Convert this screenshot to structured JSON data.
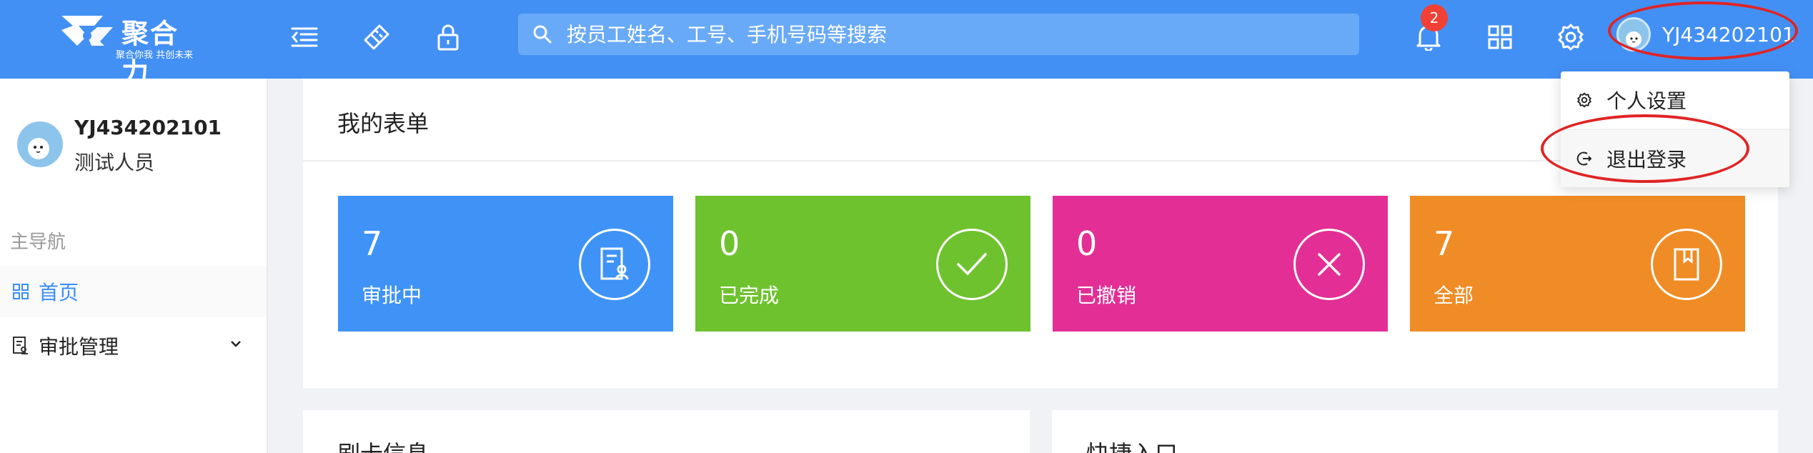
{
  "header": {
    "logo_name": "聚合力",
    "logo_slogan": "聚合你我 共创未来",
    "search_placeholder": "按员工姓名、工号、手机号码等搜索",
    "notification_count": "2",
    "user_name": "YJ434202101",
    "bg_color": "#4390f5"
  },
  "sidebar": {
    "user_name": "YJ434202101",
    "user_role": "测试人员",
    "section_title": "主导航",
    "items": [
      {
        "label": "首页",
        "icon": "grid-icon",
        "active": true
      },
      {
        "label": "审批管理",
        "icon": "approval-doc-icon",
        "expand_icon": "chevron-down-icon"
      }
    ]
  },
  "main": {
    "forms_card": {
      "title": "我的表单",
      "stats": [
        {
          "value": "7",
          "label": "审批中",
          "color": "#3f93f7",
          "icon": "form-doc-icon"
        },
        {
          "value": "0",
          "label": "已完成",
          "color": "#6ec22e",
          "icon": "check-icon"
        },
        {
          "value": "0",
          "label": "已撤销",
          "color": "#e32f95",
          "icon": "x-icon"
        },
        {
          "value": "7",
          "label": "全部",
          "color": "#f08c25",
          "icon": "book-icon"
        }
      ]
    },
    "bottom_cards": [
      {
        "title": "刷卡信息"
      },
      {
        "title": "快捷入口"
      }
    ]
  },
  "dropdown": {
    "items": [
      {
        "label": "个人设置",
        "icon": "gear-icon"
      },
      {
        "label": "退出登录",
        "icon": "logout-icon"
      }
    ]
  }
}
